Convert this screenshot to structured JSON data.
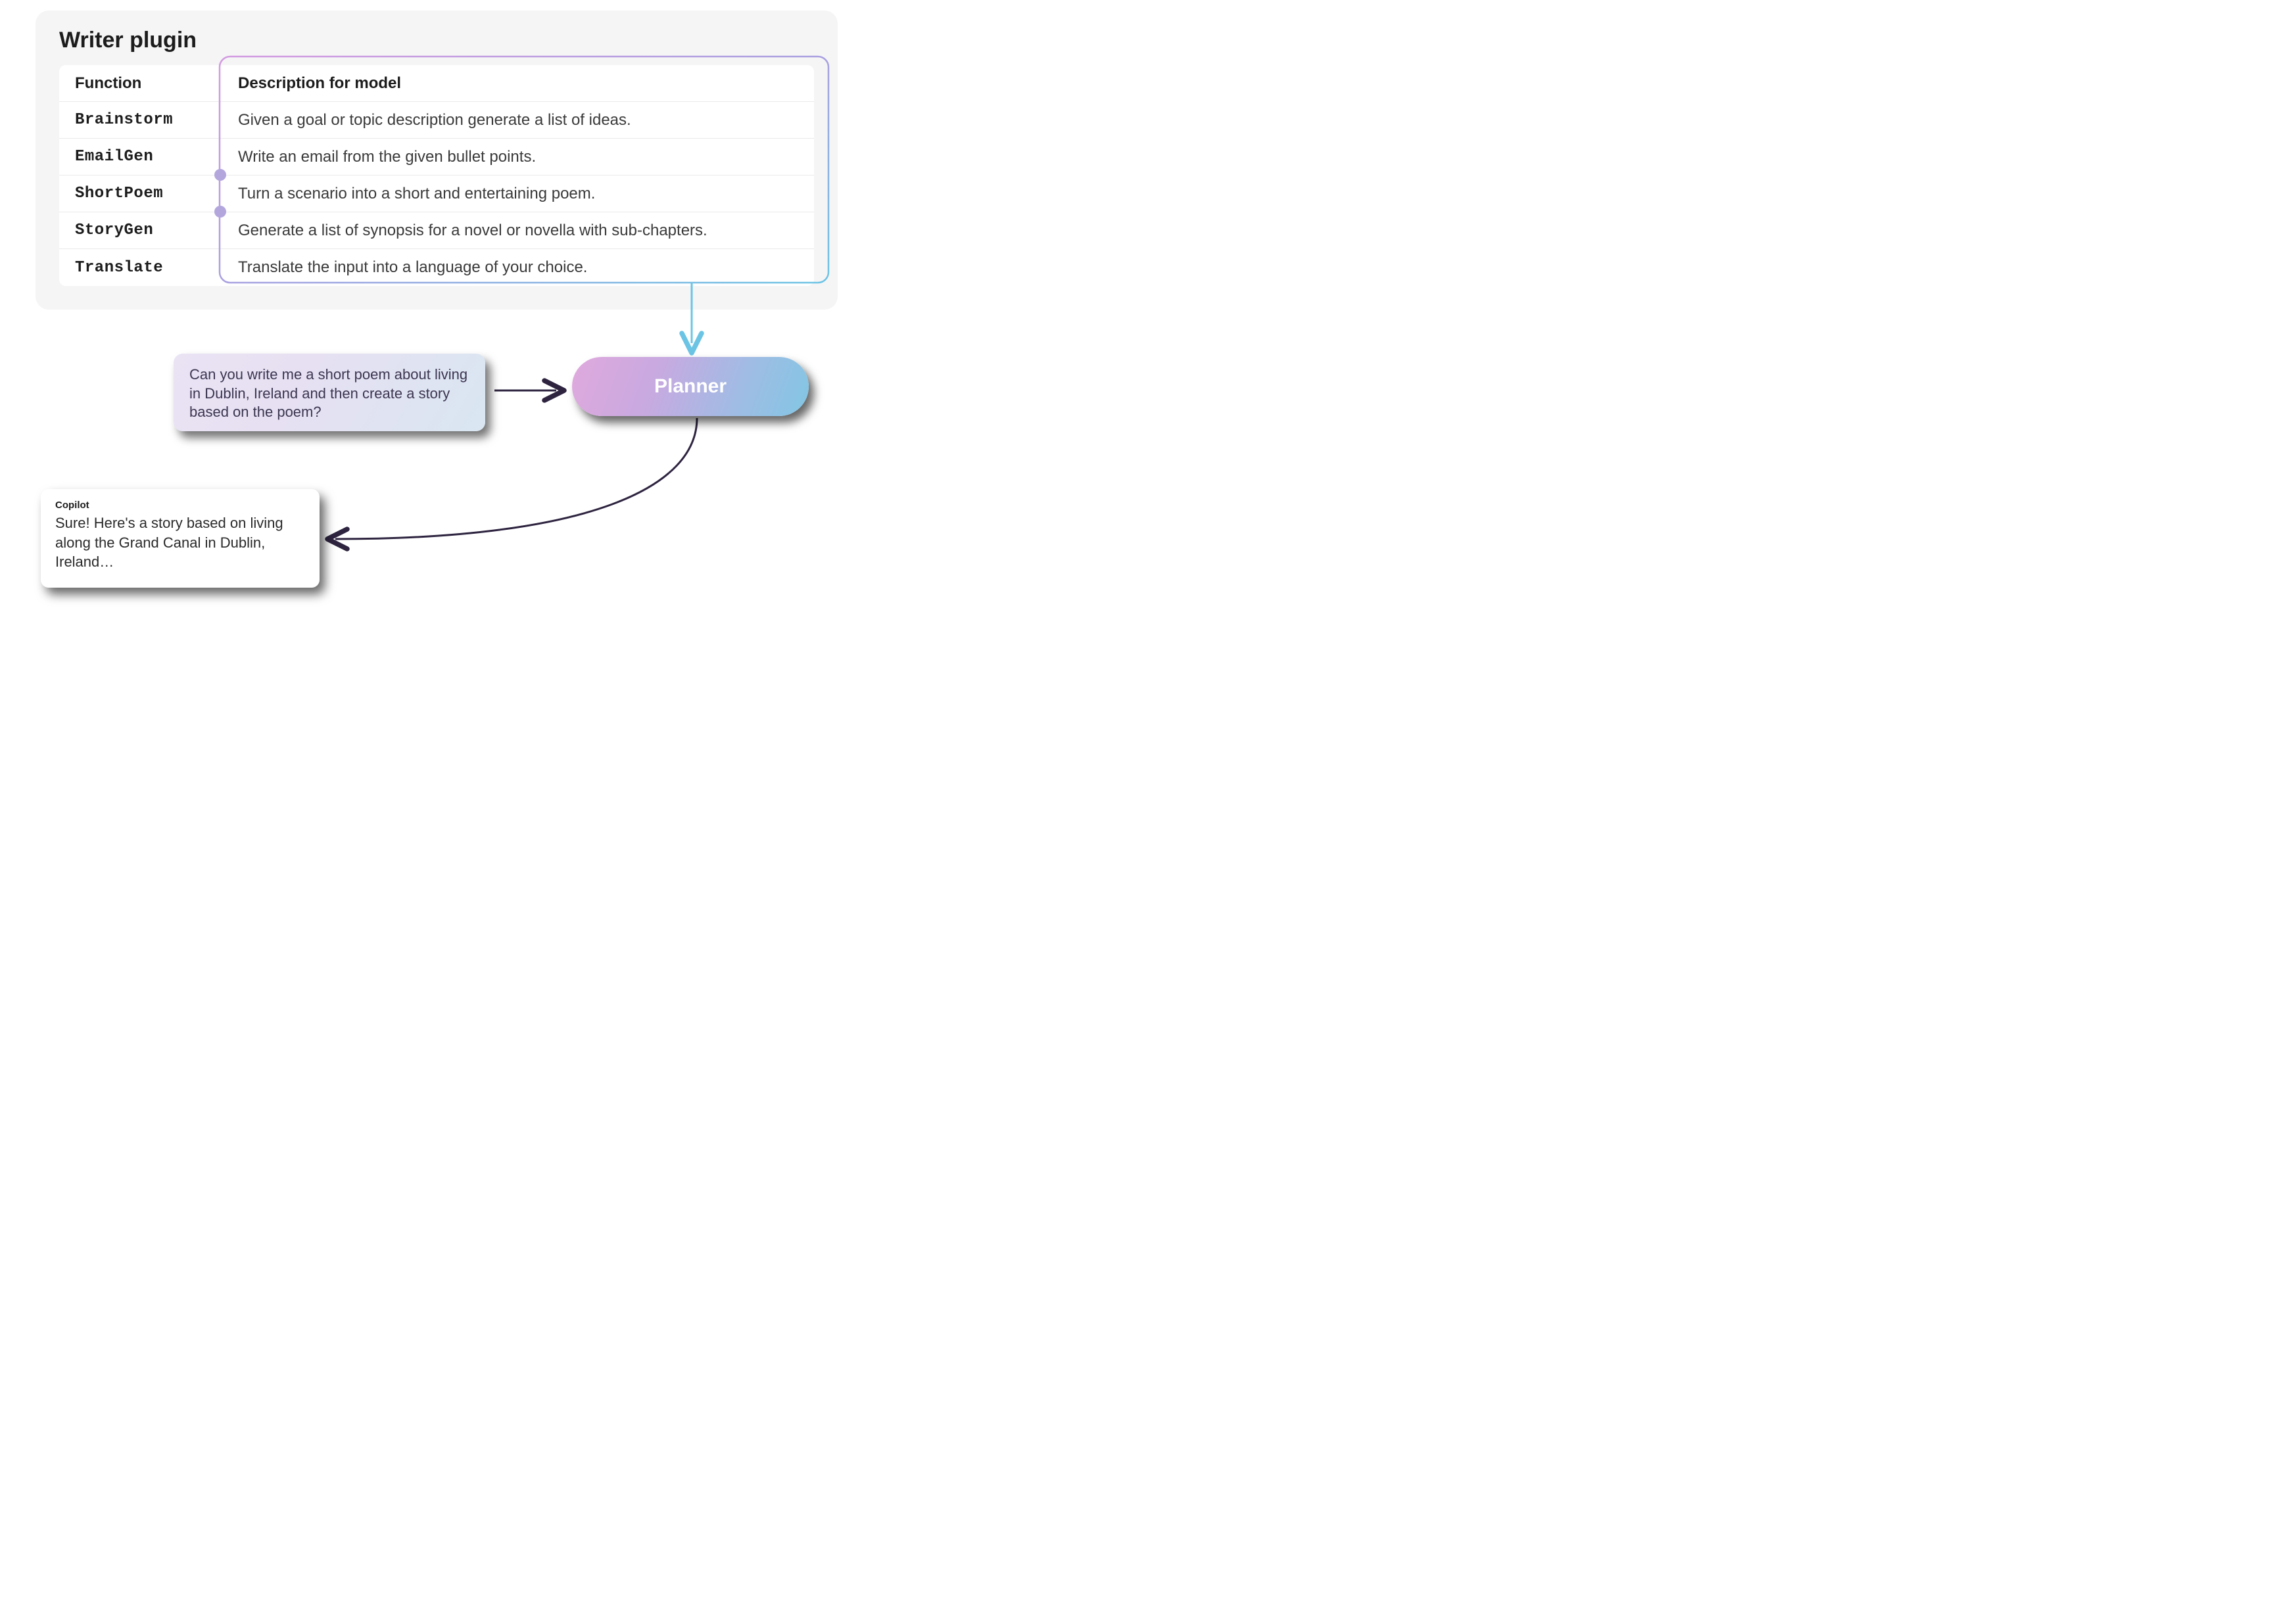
{
  "plugin": {
    "title": "Writer plugin",
    "headers": {
      "fn": "Function",
      "desc": "Description for model"
    },
    "rows": [
      {
        "fn": "Brainstorm",
        "desc": "Given a goal or topic description generate a list of ideas."
      },
      {
        "fn": "EmailGen",
        "desc": "Write an email from the given bullet points."
      },
      {
        "fn": "ShortPoem",
        "desc": "Turn a scenario into a short and entertaining poem."
      },
      {
        "fn": "StoryGen",
        "desc": "Generate a list of synopsis for a novel or novella with sub-chapters."
      },
      {
        "fn": "Translate",
        "desc": "Translate the input into a language of your choice."
      }
    ]
  },
  "prompt": {
    "text": "Can you write me a short poem about living in Dublin, Ireland and then create a story based on the poem?"
  },
  "planner": {
    "label": "Planner"
  },
  "response": {
    "label": "Copilot",
    "text": "Sure! Here's a story based on living along the Grand Canal in Dublin, Ireland…"
  }
}
